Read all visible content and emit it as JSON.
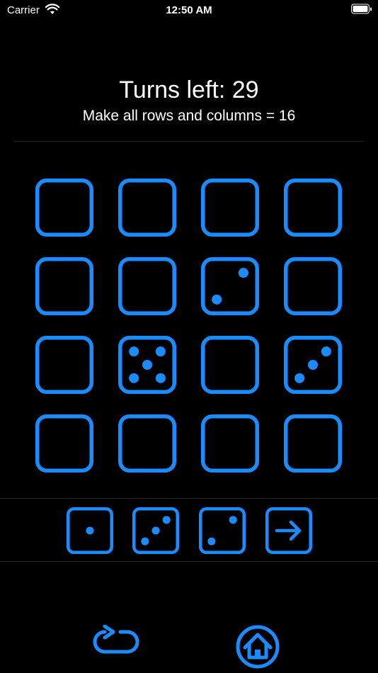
{
  "status_bar": {
    "carrier": "Carrier",
    "time": "12:50 AM"
  },
  "header": {
    "title": "Turns left: 29",
    "subtitle": "Make all rows and columns = 16"
  },
  "colors": {
    "accent": "#1a8cff",
    "background": "#000000",
    "divider": "#2a2a2a"
  },
  "board": {
    "rows": [
      [
        0,
        0,
        0,
        0
      ],
      [
        0,
        0,
        2,
        0
      ],
      [
        0,
        5,
        0,
        3
      ],
      [
        0,
        0,
        0,
        0
      ]
    ]
  },
  "tray": {
    "dice": [
      1,
      3,
      2
    ],
    "next_icon": "arrow-right-icon"
  },
  "toolbar": {
    "restart_icon": "repeat-icon",
    "home_icon": "home-icon"
  }
}
